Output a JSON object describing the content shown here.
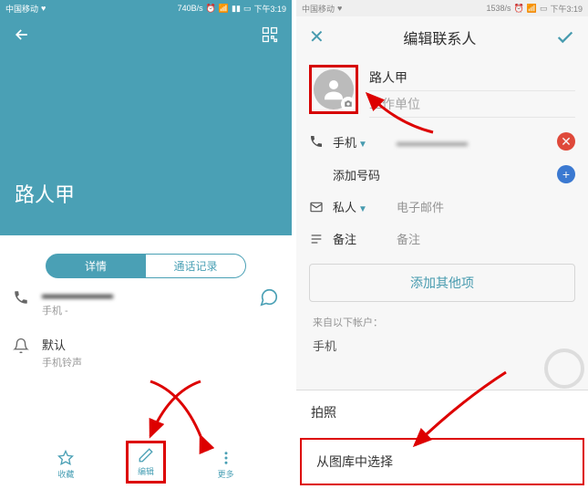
{
  "left": {
    "status": {
      "carrier": "中国移动",
      "speed": "740B/s",
      "time": "下午3:19"
    },
    "contact_name": "路人甲",
    "tabs": {
      "details": "详情",
      "calllog": "通话记录"
    },
    "phone": {
      "label": "手机",
      "sub": "手机 - "
    },
    "ringtone": {
      "label": "默认",
      "sub": "手机铃声"
    },
    "bottom": {
      "fav": "收藏",
      "edit": "编辑",
      "more": "更多"
    }
  },
  "right": {
    "status": {
      "carrier": "中国移动",
      "speed": "1538/s",
      "time": "下午3:19"
    },
    "title": "编辑联系人",
    "name": "路人甲",
    "work_placeholder": "工作单位",
    "phone_label": "手机",
    "add_number": "添加号码",
    "email_type": "私人",
    "email_placeholder": "电子邮件",
    "note_label": "备注",
    "note_placeholder": "备注",
    "add_other": "添加其他项",
    "from_account": "来自以下帐户：",
    "account": "手机",
    "sheet": {
      "camera": "拍照",
      "gallery": "从图库中选择"
    }
  }
}
